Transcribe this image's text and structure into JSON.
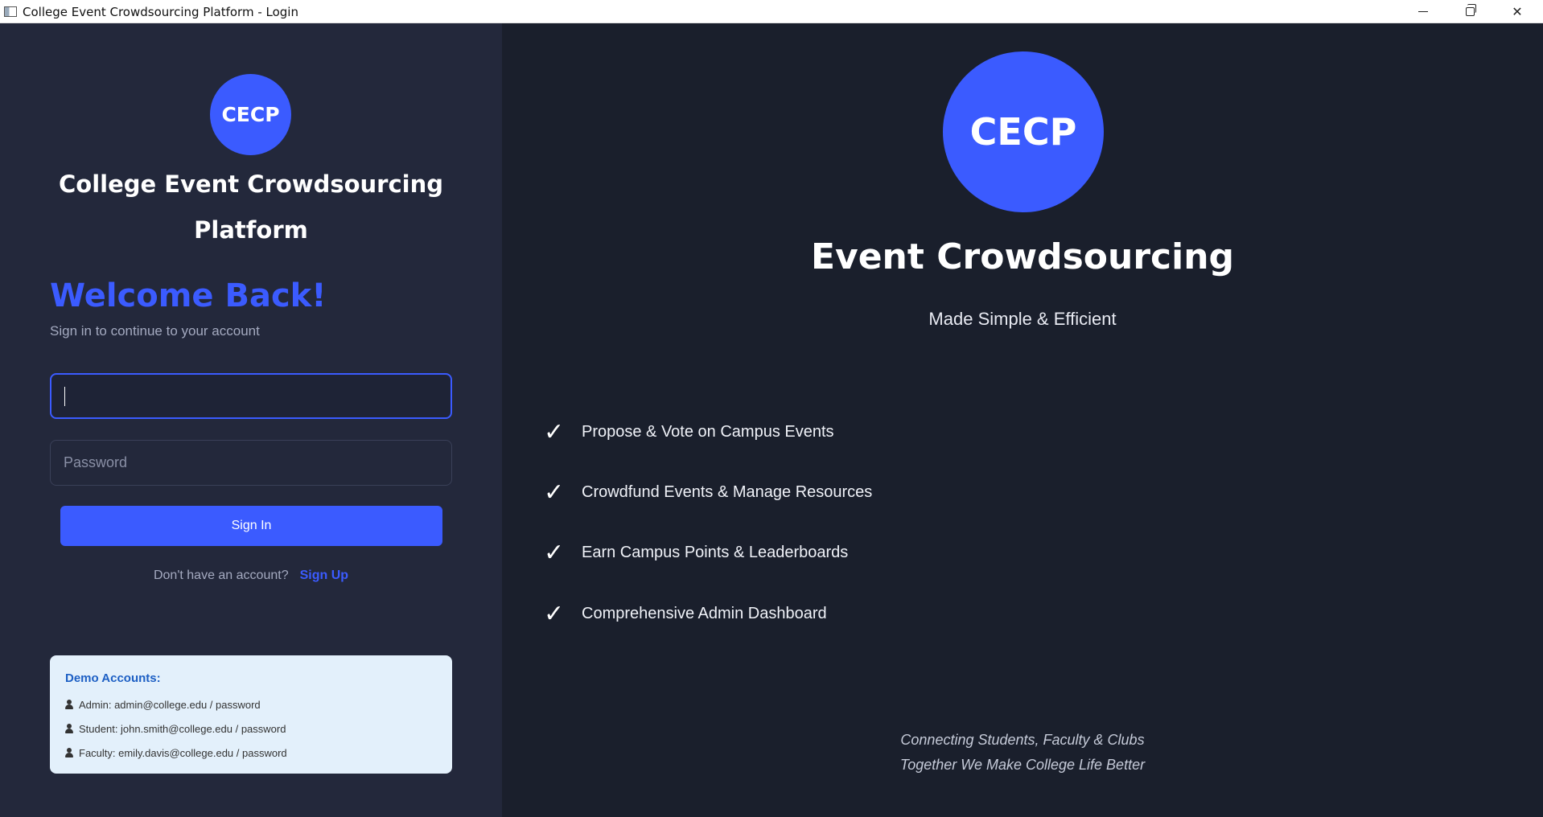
{
  "window": {
    "title": "College Event Crowdsourcing Platform - Login",
    "controls": {
      "minimize": "minimize",
      "maximize": "restore",
      "close": "close"
    }
  },
  "login": {
    "logo_text": "CECP",
    "app_title": "College Event Crowdsourcing Platform",
    "welcome": "Welcome Back!",
    "subtitle": "Sign in to continue to your account",
    "email_value": "",
    "password_placeholder": "Password",
    "signin_label": "Sign In",
    "no_account_text": "Don't have an account?",
    "signup_label": "Sign Up"
  },
  "demo": {
    "title": "Demo Accounts:",
    "accounts": [
      "Admin: admin@college.edu / password",
      "Student: john.smith@college.edu / password",
      "Faculty: emily.davis@college.edu / password"
    ]
  },
  "hero": {
    "logo_text": "CECP",
    "title": "Event Crowdsourcing",
    "subtitle": "Made Simple & Efficient",
    "check_symbol": "✓",
    "features": [
      "Propose & Vote on Campus Events",
      "Crowdfund Events & Manage Resources",
      "Earn Campus Points & Leaderboards",
      "Comprehensive Admin Dashboard"
    ],
    "footer": [
      "Connecting Students, Faculty & Clubs",
      "Together We Make College Life Better"
    ]
  },
  "colors": {
    "accent": "#3b5bff",
    "left_bg": "#23283b",
    "right_bg": "#1a1f2c",
    "demo_bg": "#e3f0fb",
    "demo_title": "#1d5fc4"
  }
}
